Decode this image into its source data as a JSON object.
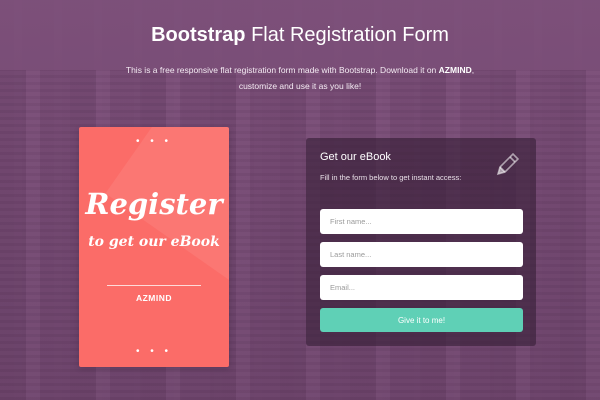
{
  "header": {
    "title_strong": "Bootstrap",
    "title_light": "Flat Registration Form",
    "subtitle_before": "This is a free responsive flat registration form made with Bootstrap. Download it on",
    "subtitle_brand": "AZMIND",
    "subtitle_after": ", customize and use it as you like!"
  },
  "book": {
    "dots_top": "• • •",
    "title": "Register",
    "subtitle": "to get our eBook",
    "brand": "AZMIND",
    "dots_bottom": "• • •",
    "color": "#fb6c68"
  },
  "form": {
    "title": "Get our eBook",
    "description": "Fill in the form below to get instant access:",
    "icon": "pencil-icon",
    "first_name_placeholder": "First name...",
    "last_name_placeholder": "Last name...",
    "email_placeholder": "Email...",
    "submit_label": "Give it to me!",
    "submit_color": "#5fd0b6"
  },
  "colors": {
    "background": "#7a4f78",
    "panel": "#3a2239"
  }
}
